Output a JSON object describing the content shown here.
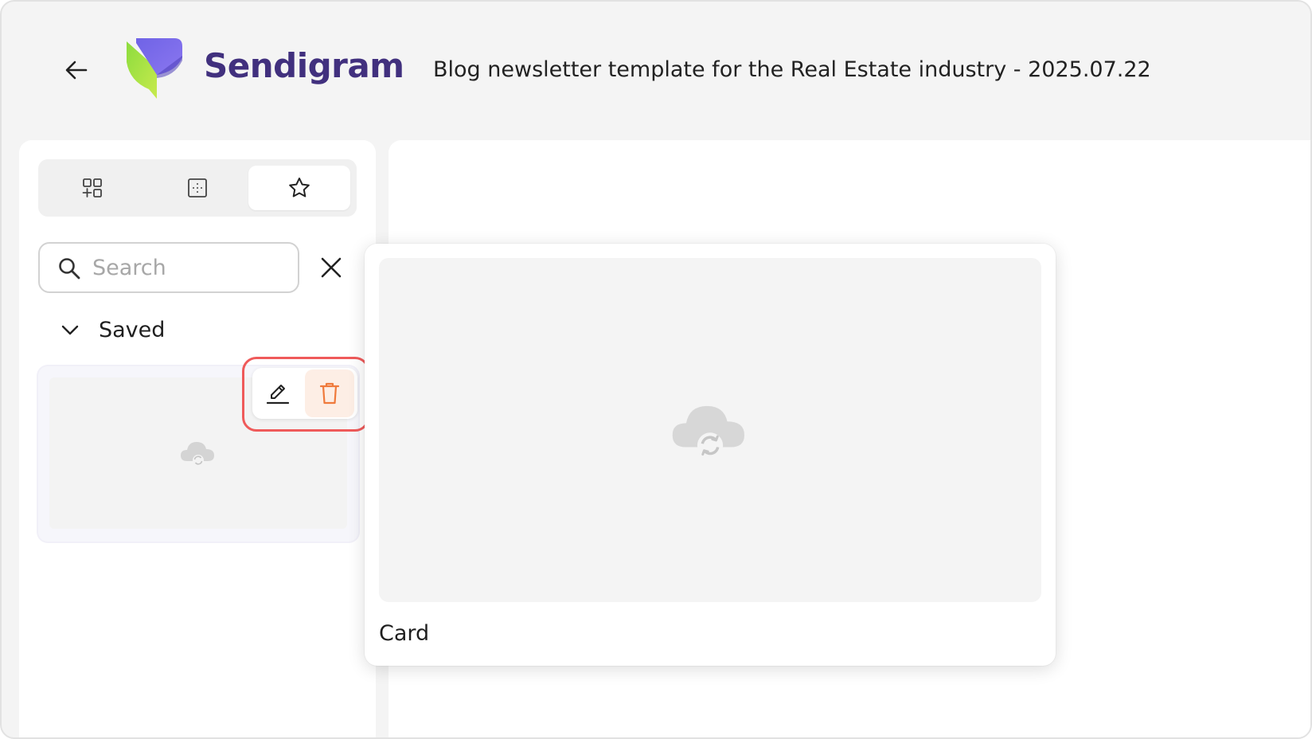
{
  "header": {
    "back_icon": "arrow-left-icon",
    "brand_name": "Sendigram",
    "document_title": "Blog newsletter template for the Real Estate industry - 2025.07.22",
    "brand_color": "#41307e"
  },
  "sidebar": {
    "tabs": [
      {
        "icon": "blocks-grid-icon",
        "active": false
      },
      {
        "icon": "layout-frame-icon",
        "active": false
      },
      {
        "icon": "star-icon",
        "active": true
      }
    ],
    "search": {
      "placeholder": "Search",
      "value": ""
    },
    "section": {
      "label": "Saved",
      "expanded": true
    },
    "saved_item": {
      "thumbnail_icon": "cloud-sync-icon",
      "actions": [
        {
          "icon": "edit-pencil-icon"
        },
        {
          "icon": "trash-icon",
          "color": "#ef7a3c"
        }
      ]
    }
  },
  "preview": {
    "thumbnail_icon": "cloud-sync-icon",
    "label": "Card"
  },
  "colors": {
    "highlight": "#ef5a5a",
    "delete_bg": "#fdeee5",
    "delete_icon": "#ef7a3c"
  }
}
